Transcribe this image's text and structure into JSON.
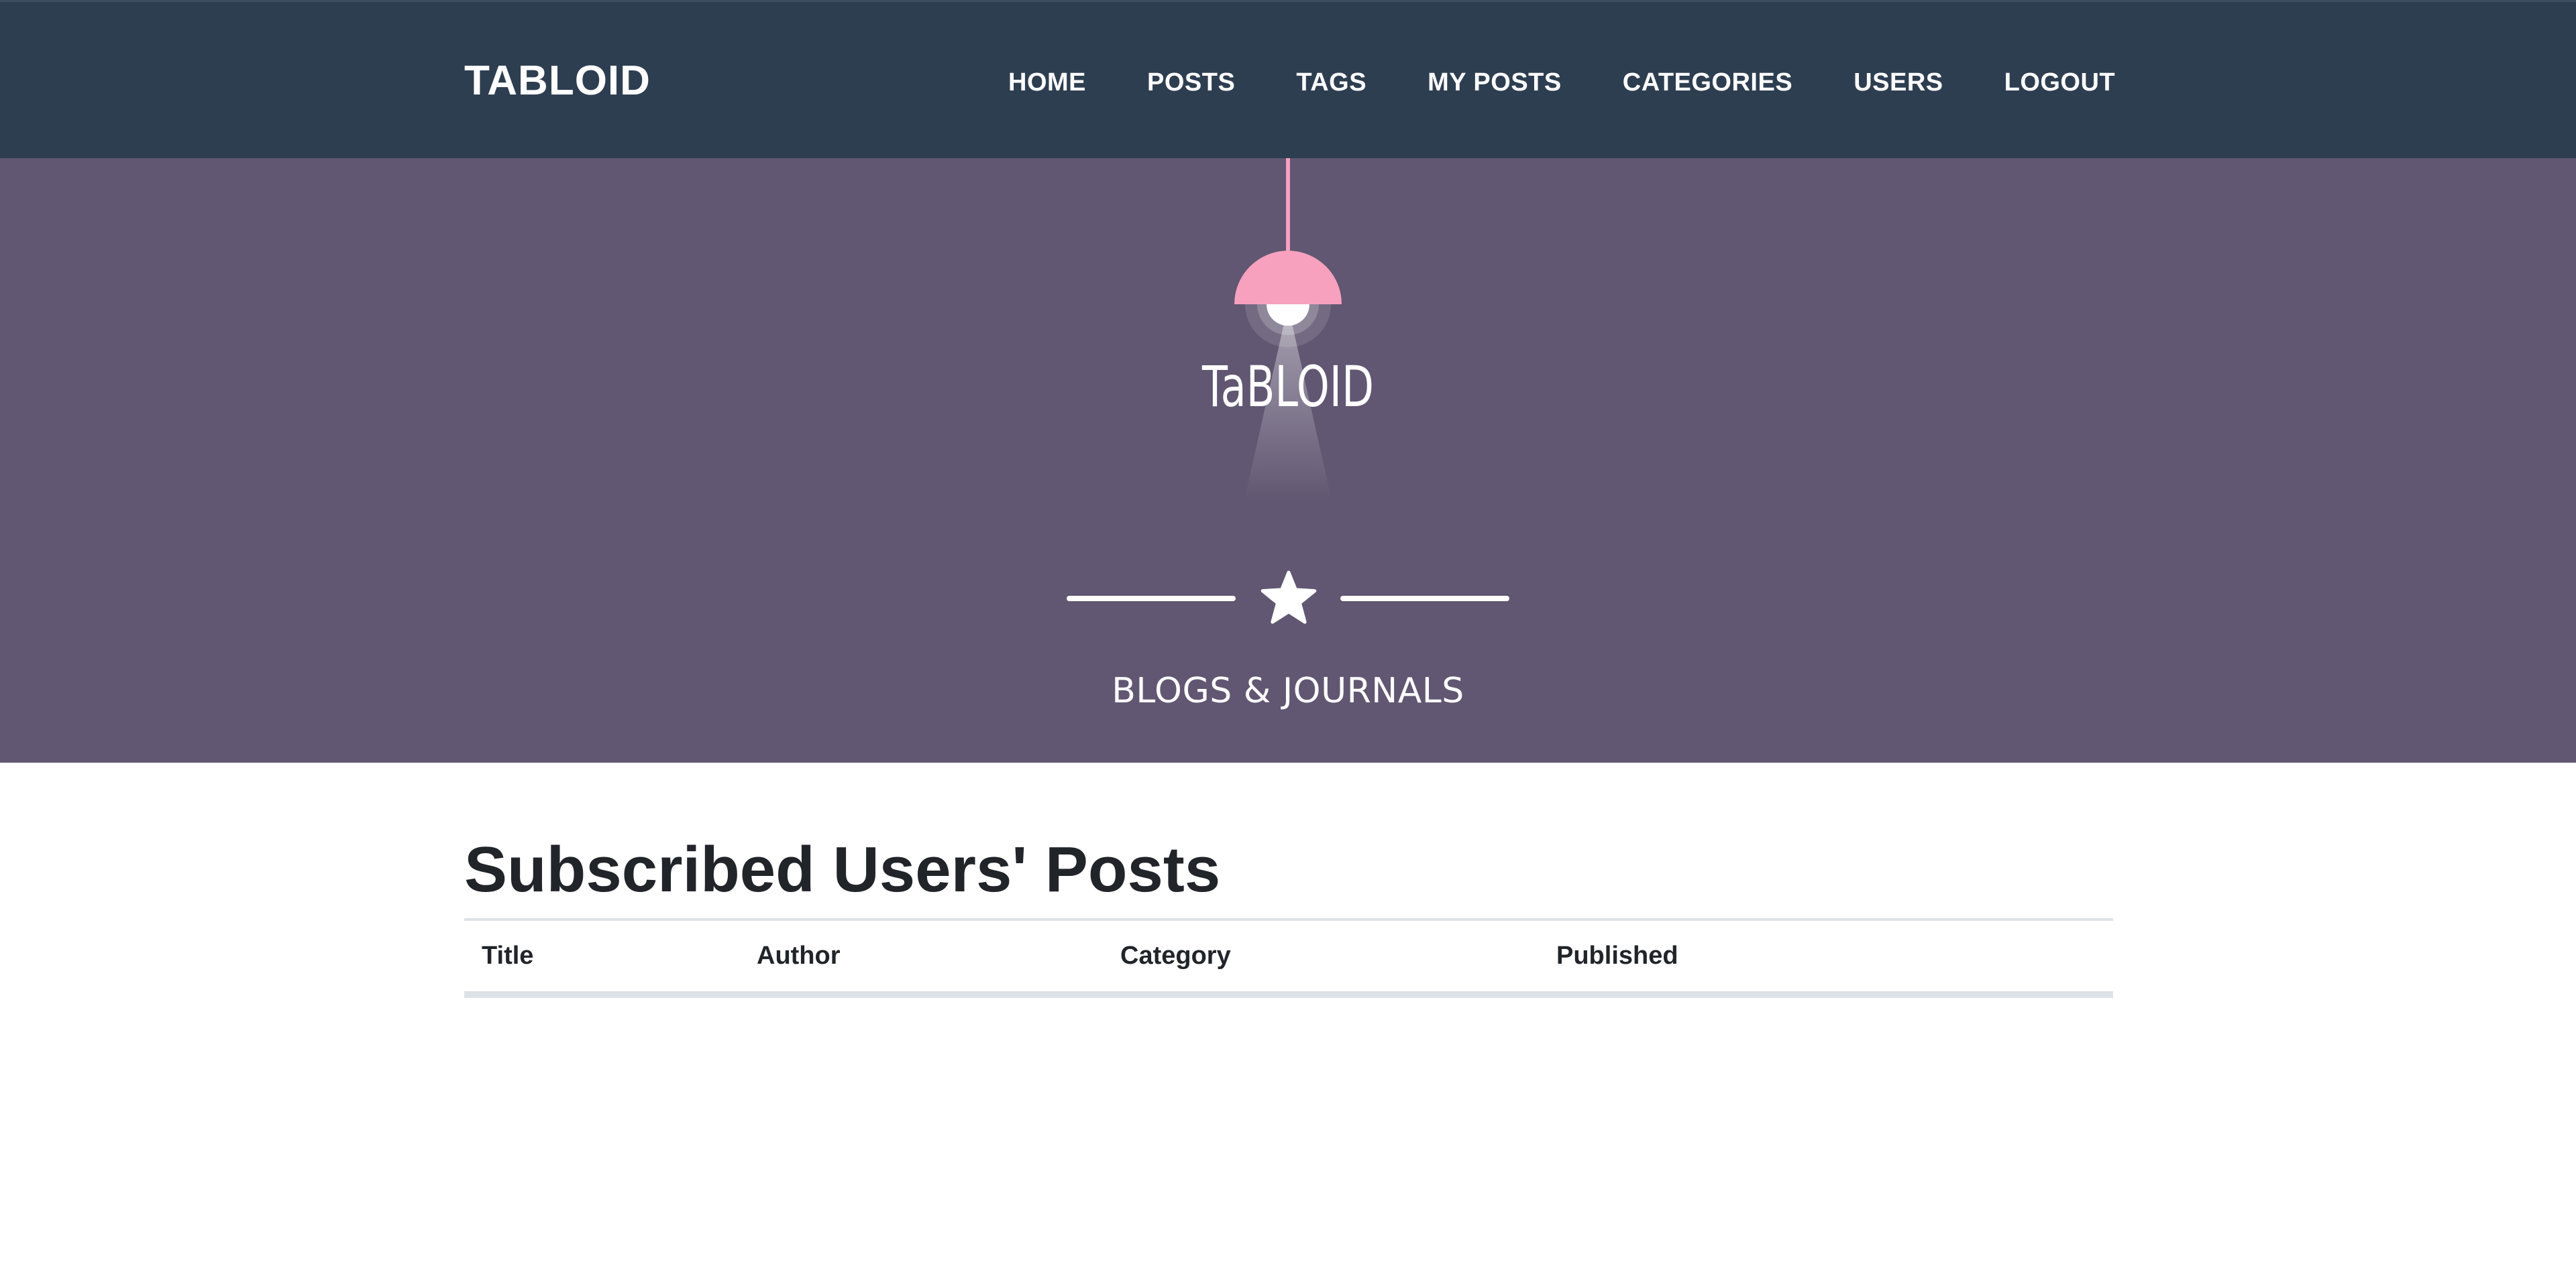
{
  "navbar": {
    "brand": "TABLOID",
    "links": [
      {
        "label": "Home"
      },
      {
        "label": "Posts"
      },
      {
        "label": "Tags"
      },
      {
        "label": "My Posts"
      },
      {
        "label": "Categories"
      },
      {
        "label": "Users"
      },
      {
        "label": "Logout"
      }
    ],
    "background_color": "#2e3e51"
  },
  "masthead": {
    "logo_text": "TaBLOID",
    "subheading": "BLOGS & JOURNALS",
    "background_color": "#615772",
    "lamp_color": "#f7a1bf",
    "divider_icon": "star-icon"
  },
  "main": {
    "title": "Subscribed Users' Posts",
    "table": {
      "columns": [
        "Title",
        "Author",
        "Category",
        "Published"
      ],
      "rows": []
    }
  }
}
